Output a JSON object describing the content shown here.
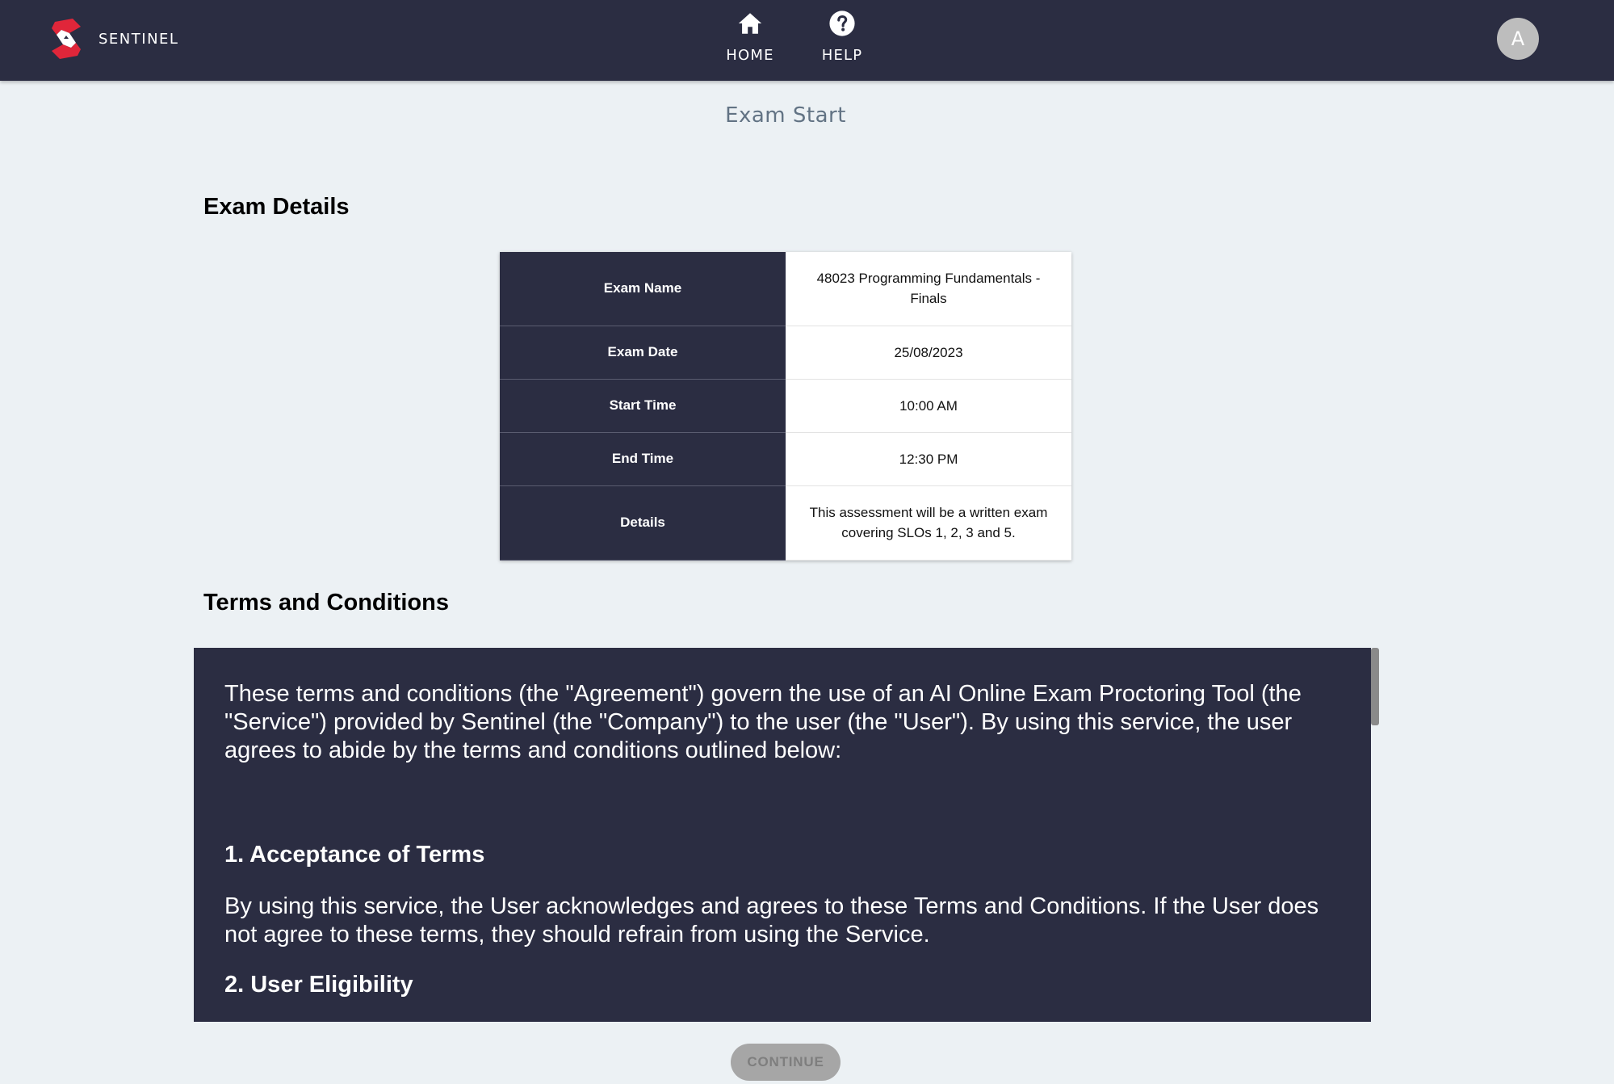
{
  "app": {
    "brand_name": "SENTINEL",
    "brand_icon": "sentinel-logo"
  },
  "nav": {
    "items": [
      {
        "label": "HOME",
        "icon": "home-icon"
      },
      {
        "label": "HELP",
        "icon": "help-icon"
      }
    ],
    "avatar_initial": "A"
  },
  "page": {
    "title": "Exam Start"
  },
  "exam_details": {
    "heading": "Exam Details",
    "rows": [
      {
        "label": "Exam Name",
        "value": "48023 Programming Fundamentals - Finals"
      },
      {
        "label": "Exam Date",
        "value": "25/08/2023"
      },
      {
        "label": "Start Time",
        "value": "10:00 AM"
      },
      {
        "label": "End Time",
        "value": "12:30 PM"
      },
      {
        "label": "Details",
        "value": "This assessment will be a written exam covering SLOs 1, 2, 3 and 5."
      }
    ]
  },
  "terms": {
    "heading": "Terms and Conditions",
    "intro": "These terms and conditions (the \"Agreement\") govern the use of an AI Online Exam Proctoring Tool (the \"Service\") provided by Sentinel (the \"Company\") to the user (the \"User\"). By using this service, the user agrees to abide by the terms and conditions outlined below:",
    "sections": [
      {
        "title": "1. Acceptance of Terms",
        "text": "By using this service, the User acknowledges and agrees to these Terms and Conditions. If the User does not agree to these terms, they should refrain from using the Service."
      },
      {
        "title": "2. User Eligibility",
        "text": ""
      }
    ]
  },
  "actions": {
    "continue_label": "CONTINUE"
  },
  "colors": {
    "navbar": "#2b2d42",
    "background": "#ecf1f4",
    "logo_red": "#e0263a",
    "button_disabled": "#a6a6a6"
  }
}
